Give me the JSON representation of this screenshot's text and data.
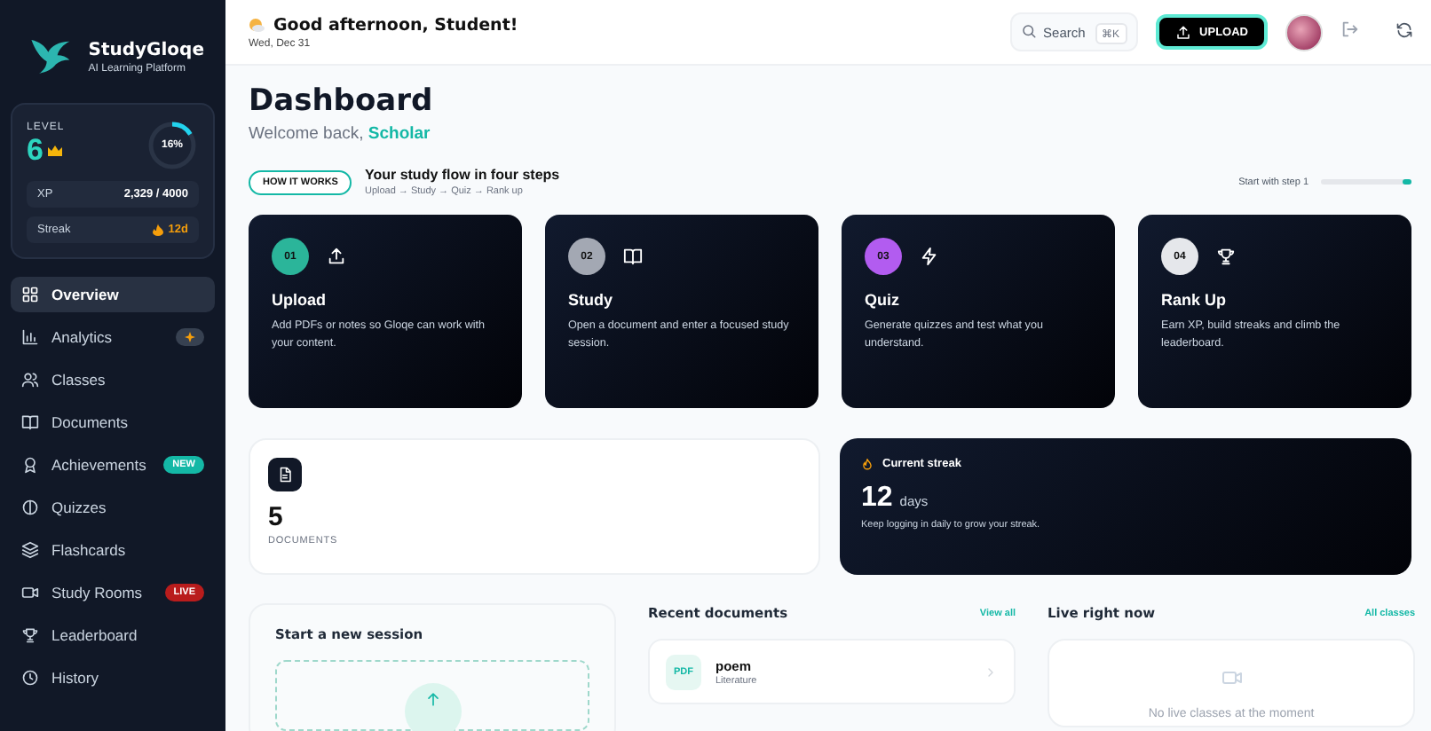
{
  "brand": {
    "name": "StudyGloqe",
    "tagline": "AI Learning Platform"
  },
  "level_card": {
    "label": "LEVEL",
    "level_value": "6",
    "progress": {
      "level": 0.16,
      "reading": "16%"
    },
    "xp": {
      "label": "XP",
      "value": "2,329 / 4000"
    },
    "streak": {
      "label": "Streak",
      "value": "12d"
    }
  },
  "sidebar": {
    "items": [
      {
        "label": "Overview",
        "selected": true
      },
      {
        "label": "Analytics",
        "selected": false,
        "badge": {
          "kind": "icon"
        }
      },
      {
        "label": "Classes",
        "selected": false
      },
      {
        "label": "Documents",
        "selected": false
      },
      {
        "label": "Achievements",
        "selected": false,
        "badge": {
          "kind": "text",
          "text": "NEW",
          "color": "#14b8a6"
        }
      },
      {
        "label": "Quizzes",
        "selected": false
      },
      {
        "label": "Flashcards",
        "selected": false
      },
      {
        "label": "Study Rooms",
        "selected": false,
        "badge": {
          "kind": "text",
          "text": "LIVE",
          "color": "#b91c1c"
        }
      },
      {
        "label": "Leaderboard",
        "selected": false
      },
      {
        "label": "History",
        "selected": false
      }
    ]
  },
  "header": {
    "greeting": "Good afternoon, Student!",
    "date": "Wed, Dec 31",
    "search": {
      "placeholder": "Search",
      "shortcut": "⌘K"
    },
    "upload_button": "UPLOAD"
  },
  "page": {
    "title": "Dashboard",
    "welcome": "Welcome back, ",
    "user": "Scholar"
  },
  "how_it_works": {
    "pill": "HOW IT WORKS",
    "title": "Your study flow in four steps",
    "subtitle": "Upload → Study → Quiz → Rank up",
    "progress_label": "Start with step 1",
    "progress": {
      "level": 0.1
    }
  },
  "steps": [
    {
      "number": "01",
      "title": "Upload",
      "text": "Add PDFs or notes so Gloqe can work with your content.",
      "color": "#2bb59a"
    },
    {
      "number": "02",
      "title": "Study",
      "text": "Open a document and enter a focused study session.",
      "color": "#a3a8b3"
    },
    {
      "number": "03",
      "title": "Quiz",
      "text": "Generate quizzes and test what you understand.",
      "color": "#b25cf0"
    },
    {
      "number": "04",
      "title": "Rank Up",
      "text": "Earn XP, build streaks and climb the leaderboard.",
      "color": "#e5e7eb"
    }
  ],
  "documents_stat": {
    "value": "5",
    "label": "DOCUMENTS"
  },
  "streak_card": {
    "title": "Current streak",
    "value": "12",
    "unit": "days",
    "text": "Keep logging in daily to grow your streak."
  },
  "session_card": {
    "title": "Start a new session"
  },
  "recent_documents": {
    "title": "Recent documents",
    "link": "View all",
    "items": [
      {
        "type": "PDF",
        "name": "poem",
        "subject": "Literature"
      }
    ]
  },
  "live": {
    "title": "Live right now",
    "link": "All classes",
    "empty_text": "No live classes at the moment"
  }
}
